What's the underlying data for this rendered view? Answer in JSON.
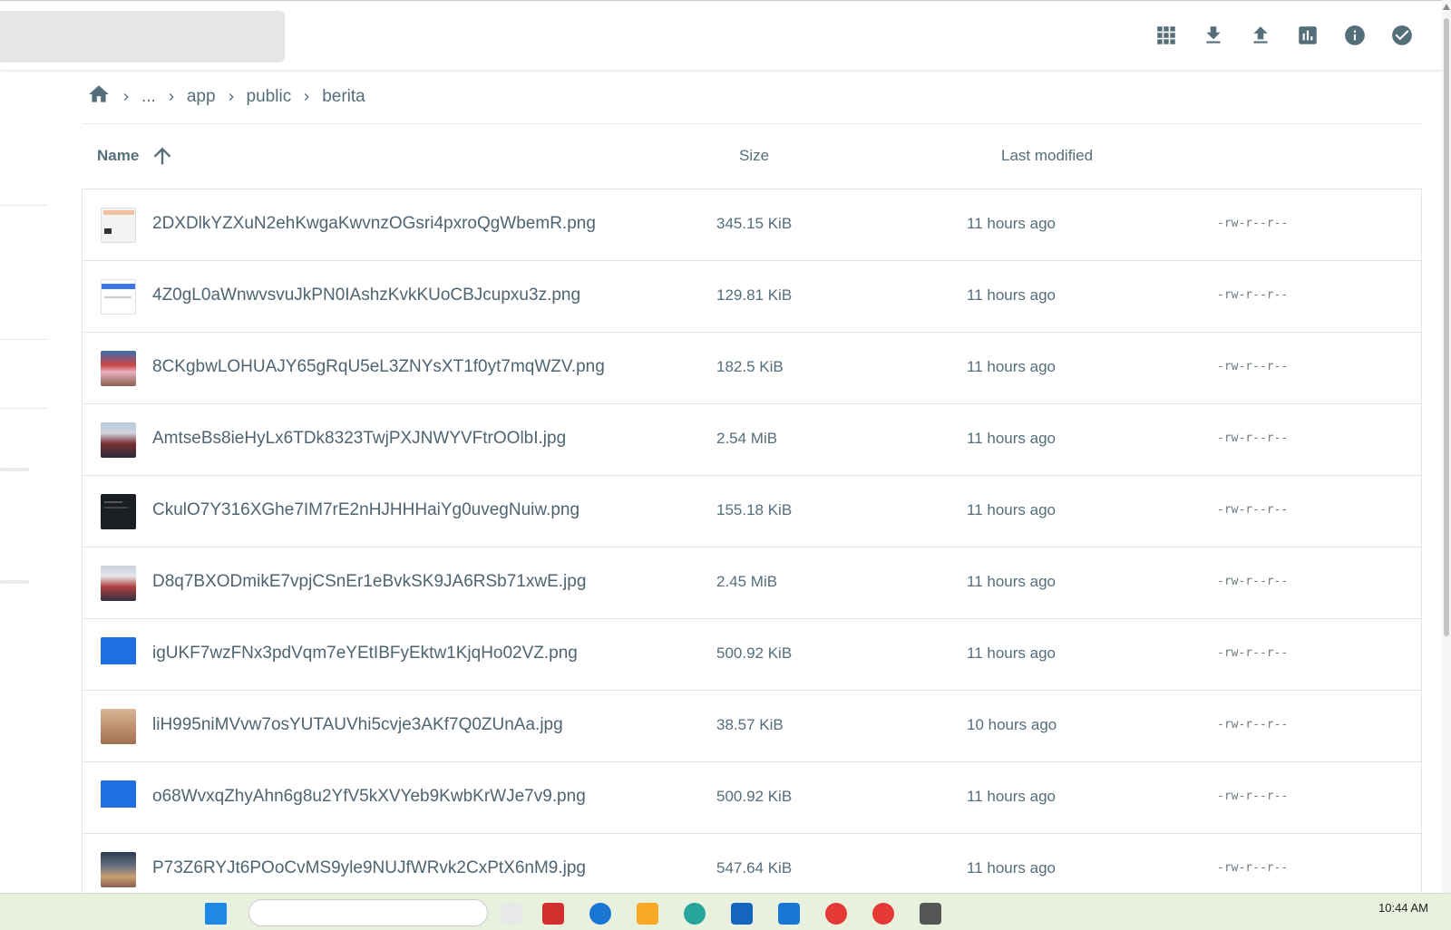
{
  "header": {
    "search_placeholder": "",
    "toolbar": [
      {
        "name": "grid-view-icon",
        "label": "Switch view"
      },
      {
        "name": "download-icon",
        "label": "Download"
      },
      {
        "name": "upload-icon",
        "label": "Upload"
      },
      {
        "name": "chart-icon",
        "label": "Disk usage"
      },
      {
        "name": "info-icon",
        "label": "Info"
      },
      {
        "name": "check-circle-icon",
        "label": "Select multiple"
      }
    ]
  },
  "breadcrumb": {
    "home": "home-icon",
    "items": [
      "...",
      "app",
      "public",
      "berita"
    ]
  },
  "columns": {
    "name": "Name",
    "size": "Size",
    "modified": "Last modified"
  },
  "files": [
    {
      "name": "2DXDlkYZXuN2ehKwgaKwvnzOGsri4pxroQgWbemR.png",
      "size": "345.15 KiB",
      "modified": "11 hours ago",
      "perm": "-rw-r--r--",
      "thumb": "doc"
    },
    {
      "name": "4Z0gL0aWnwvsvuJkPN0IAshzKvkKUoCBJcupxu3z.png",
      "size": "129.81 KiB",
      "modified": "11 hours ago",
      "perm": "-rw-r--r--",
      "thumb": "web"
    },
    {
      "name": "8CKgbwLOHUAJY65gRqU5eL3ZNYsXT1f0yt7mqWZV.png",
      "size": "182.5 KiB",
      "modified": "11 hours ago",
      "perm": "-rw-r--r--",
      "thumb": "photo1"
    },
    {
      "name": "AmtseBs8ieHyLx6TDk8323TwjPXJNWYVFtrOOlbI.jpg",
      "size": "2.54 MiB",
      "modified": "11 hours ago",
      "perm": "-rw-r--r--",
      "thumb": "photo2"
    },
    {
      "name": "CkulO7Y316XGhe7IM7rE2nHJHHHaiYg0uvegNuiw.png",
      "size": "155.18 KiB",
      "modified": "11 hours ago",
      "perm": "-rw-r--r--",
      "thumb": "dark"
    },
    {
      "name": "D8q7BXODmikE7vpjCSnEr1eBvkSK9JA6RSb71xwE.jpg",
      "size": "2.45 MiB",
      "modified": "11 hours ago",
      "perm": "-rw-r--r--",
      "thumb": "photo3"
    },
    {
      "name": "igUKF7wzFNx3pdVqm7eYEtIBFyEktw1KjqHo02VZ.png",
      "size": "500.92 KiB",
      "modified": "11 hours ago",
      "perm": "-rw-r--r--",
      "thumb": "blue"
    },
    {
      "name": "liH995niMVvw7osYUTAUVhi5cvje3AKf7Q0ZUnAa.jpg",
      "size": "38.57 KiB",
      "modified": "10 hours ago",
      "perm": "-rw-r--r--",
      "thumb": "room"
    },
    {
      "name": "o68WvxqZhyAhn6g8u2YfV5kXVYeb9KwbKrWJe7v9.png",
      "size": "500.92 KiB",
      "modified": "11 hours ago",
      "perm": "-rw-r--r--",
      "thumb": "blue"
    },
    {
      "name": "P73Z6RYJt6POoCvMS9yle9NUJfWRvk2CxPtX6nM9.jpg",
      "size": "547.64 KiB",
      "modified": "11 hours ago",
      "perm": "-rw-r--r--",
      "thumb": "group"
    }
  ],
  "taskbar": {
    "clock": "10:44 AM"
  },
  "colors": {
    "icon": "#546e7a",
    "border": "#e4e4e4",
    "taskbar": "#e8f0de"
  }
}
